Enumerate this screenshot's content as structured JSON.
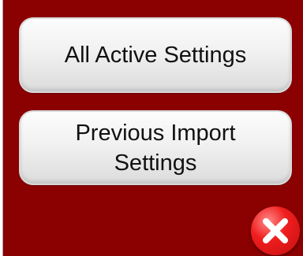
{
  "buttons": {
    "all_active": "All Active Settings",
    "previous_import_line1": "Previous Import",
    "previous_import_line2": "Settings"
  },
  "icons": {
    "close": "close-x-icon"
  },
  "colors": {
    "background": "#8b0000",
    "close_red": "#e31b1b"
  }
}
